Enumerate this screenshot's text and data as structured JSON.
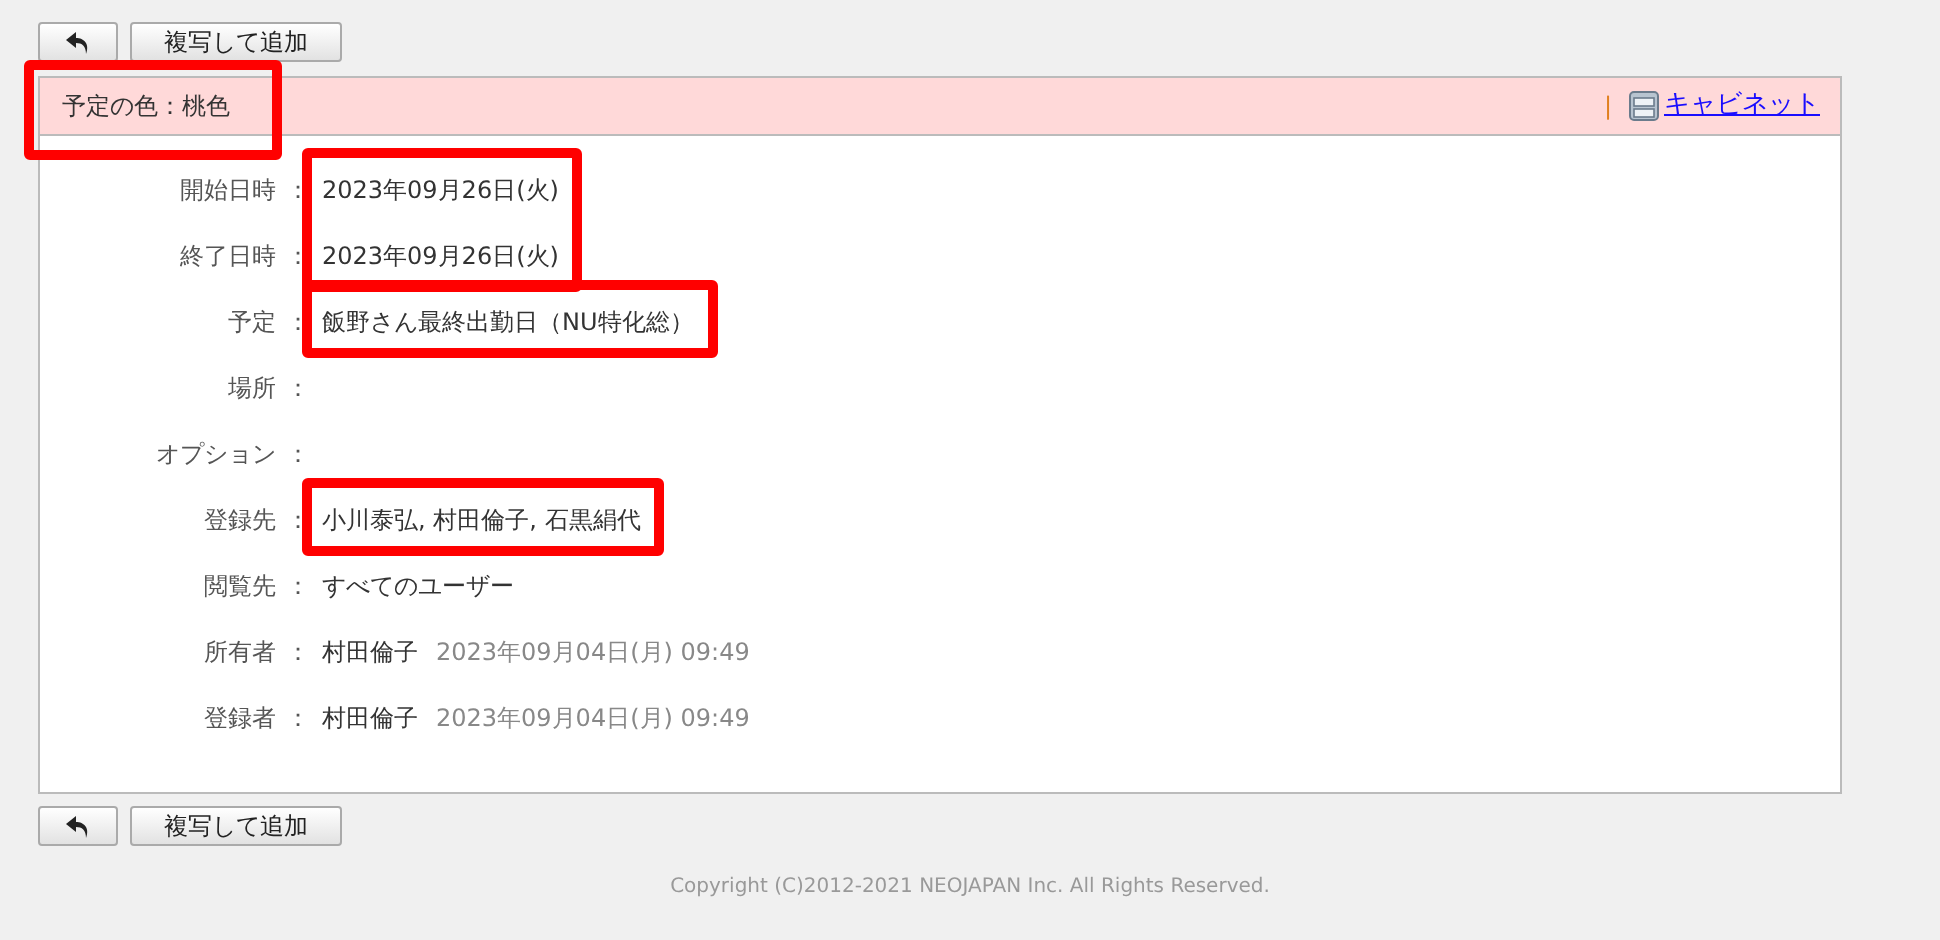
{
  "toolbar_top": {
    "buttons": [
      {
        "kind": "back"
      },
      {
        "kind": "text",
        "label": "複写して追加"
      }
    ]
  },
  "header": {
    "color_label": "予定の色：桃色",
    "color": "#ffd9d9",
    "highlighted": true,
    "separator": "|",
    "cabinet_link": "キャビネット"
  },
  "fields": [
    {
      "label": "開始日時",
      "colon": "：",
      "value": "2023年09月26日(火)",
      "highlighted": true,
      "frame_joined_with_next": true
    },
    {
      "label": "終了日時",
      "colon": "：",
      "value": "2023年09月26日(火)",
      "highlighted": true
    },
    {
      "label": "予定",
      "colon": "：",
      "value": "飯野さん最終出勤日（NU特化総）",
      "highlighted": true
    },
    {
      "label": "場所",
      "colon": "：",
      "highlighted": false
    },
    {
      "label": "オプション",
      "colon": "：",
      "highlighted": false
    },
    {
      "label": "登録先",
      "colon": "：",
      "value": "小川泰弘, 村田倫子, 石黒絹代",
      "highlighted": true
    },
    {
      "label": "閲覧先",
      "colon": "：",
      "value": "すべてのユーザー",
      "highlighted": false
    },
    {
      "label": "所有者",
      "colon": "：",
      "value": "村田倫子",
      "timestamp": "2023年09月04日(月) 09:49",
      "highlighted": false
    },
    {
      "label": "登録者",
      "colon": "：",
      "value": "村田倫子",
      "timestamp": "2023年09月04日(月) 09:49",
      "highlighted": false
    }
  ],
  "toolbar_bottom": {
    "buttons": [
      {
        "kind": "back"
      },
      {
        "kind": "text",
        "label": "複写して追加"
      }
    ]
  },
  "footer": "Copyright (C)2012-2021 NEOJAPAN Inc. All Rights Reserved."
}
